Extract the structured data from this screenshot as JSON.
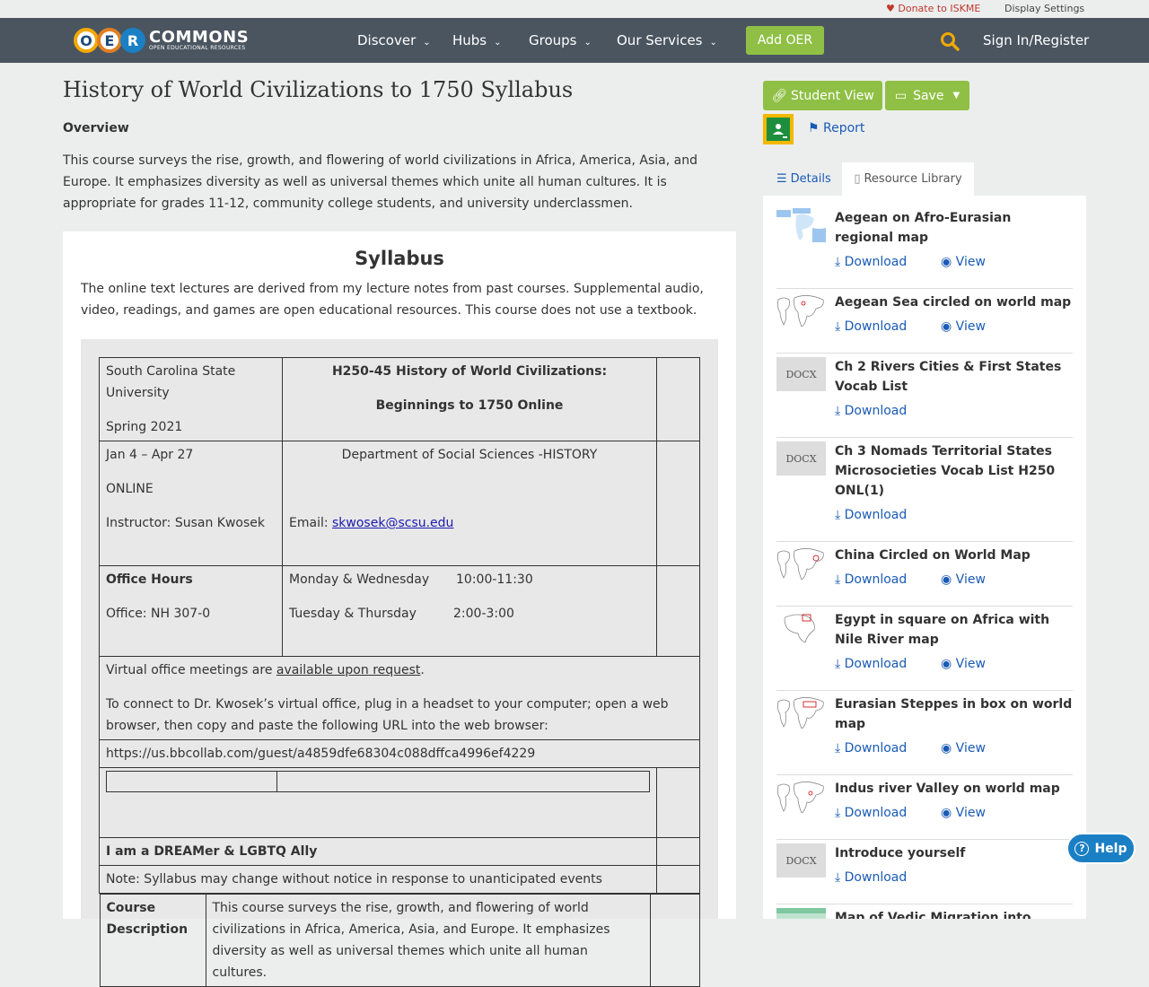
{
  "utility": {
    "donate": "Donate to ISKME",
    "display_settings": "Display Settings"
  },
  "nav": {
    "logo_letters": [
      "O",
      "E",
      "R"
    ],
    "logo_brand": "COMMONS",
    "logo_tagline": "OPEN EDUCATIONAL RESOURCES",
    "items": [
      "Discover",
      "Hubs",
      "Groups",
      "Our Services"
    ],
    "add_oer": "Add OER",
    "sign_in": "Sign In/Register"
  },
  "page": {
    "title": "History of World Civilizations to 1750 Syllabus",
    "overview_heading": "Overview",
    "overview_text": "This course surveys the rise, growth, and flowering of world civilizations in Africa, America, Asia, and Europe. It emphasizes diversity as well as universal themes which unite all human cultures. It is appropriate for grades 11-12, community college students, and university underclassmen."
  },
  "syllabus": {
    "heading": "Syllabus",
    "intro": "The online text lectures are derived from my lecture notes from past courses. Supplemental audio, video, readings, and games are open educational resources. This course does not use a textbook.",
    "university": "South Carolina State University",
    "term": "Spring 2021",
    "course_title": "H250-45 History of World Civilizations:",
    "course_subtitle": "Beginnings to 1750 Online",
    "dates": "Jan 4 – Apr 27",
    "mode": "ONLINE",
    "instructor": "Instructor: Susan Kwosek",
    "department": "Department of Social Sciences -HISTORY",
    "email_label": "Email: ",
    "email": "skwosek@scsu.edu",
    "office_hours_label": "Office Hours",
    "office": "Office: NH 307-0",
    "hours_1_days": "Monday & Wednesday",
    "hours_1_time": "10:00-11:30",
    "hours_2_days": "Tuesday & Thursday",
    "hours_2_time": "2:00-3:00",
    "virtual_pre": "Virtual office meetings are ",
    "virtual_link": "available upon request",
    "virtual_post": ".",
    "connect": "To connect to Dr. Kwosek’s virtual office, plug in a headset to your computer; open a web browser, then copy and paste the following URL into the web browser:",
    "url": "https://us.bbcollab.com/guest/a4859dfe68304c088dffca4996ef4229",
    "dreamer": "I am a DREAMer & LGBTQ Ally",
    "note": "Note: Syllabus may change without notice in response to unanticipated events",
    "course_desc_label": "Course Description",
    "course_desc_text": "This course surveys the rise, growth, and flowering of world civilizations in Africa, America, Asia, and Europe. It emphasizes diversity as well as universal themes which unite all human cultures."
  },
  "actions": {
    "student_view": "Student View",
    "save": "Save",
    "report": "Report"
  },
  "tabs": {
    "details": "Details",
    "library": "Resource Library"
  },
  "resources": [
    {
      "title": "Aegean on Afro-Eurasian regional map",
      "thumb": "map",
      "download": "Download",
      "view": "View"
    },
    {
      "title": "Aegean Sea circled on world map",
      "thumb": "map",
      "download": "Download",
      "view": "View"
    },
    {
      "title": "Ch 2 Rivers Cities & First States Vocab List",
      "thumb": "DOCX",
      "download": "Download"
    },
    {
      "title": "Ch 3 Nomads Territorial States Microsocieties Vocab List H250 ONL(1)",
      "thumb": "DOCX",
      "download": "Download"
    },
    {
      "title": "China Circled on World Map",
      "thumb": "map",
      "download": "Download",
      "view": "View"
    },
    {
      "title": "Egypt in square on Africa with Nile River map",
      "thumb": "map",
      "download": "Download",
      "view": "View"
    },
    {
      "title": "Eurasian Steppes in box on world map",
      "thumb": "map",
      "download": "Download",
      "view": "View"
    },
    {
      "title": "Indus river Valley on world map",
      "thumb": "map",
      "download": "Download",
      "view": "View"
    },
    {
      "title": "Introduce yourself",
      "thumb": "DOCX",
      "download": "Download"
    },
    {
      "title": "Map of Vedic Migration into Northern",
      "thumb": "map"
    }
  ],
  "help": "Help",
  "colors": {
    "nav_bg": "#4a5560",
    "accent_green": "#8fc045",
    "link_blue": "#1a5bb5",
    "help_blue": "#1b7fc4"
  }
}
